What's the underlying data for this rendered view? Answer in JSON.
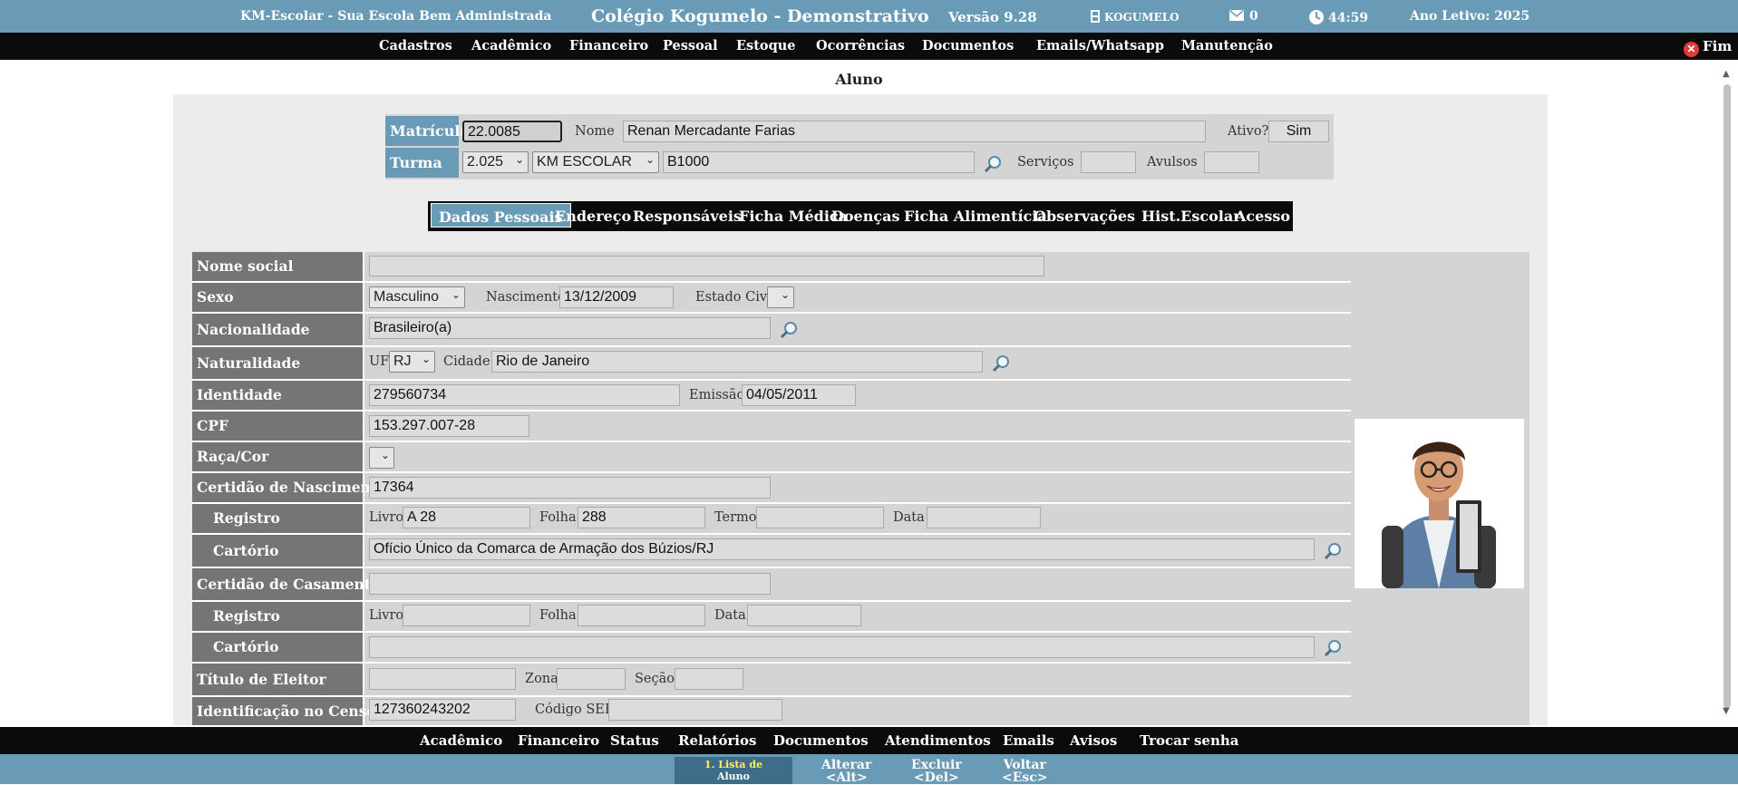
{
  "topbar": {
    "system_name": "KM-Escolar - Sua Escola Bem Administrada",
    "school_name": "Colégio Kogumelo - Demonstrativo",
    "version": "Versão 9.28",
    "user": "KOGUMELO",
    "messages": "0",
    "clock": "44:59",
    "school_year": "Ano Letivo: 2025"
  },
  "menu": {
    "items": [
      "Cadastros",
      "Acadêmico",
      "Financeiro",
      "Pessoal",
      "Estoque",
      "Ocorrências",
      "Documentos",
      "Emails/Whatsapp",
      "Manutenção"
    ],
    "exit": "Fim"
  },
  "page": {
    "title": "Aluno"
  },
  "header": {
    "matricula_label": "Matrícula",
    "matricula": "22.0085",
    "nome_label": "Nome",
    "nome": "Renan Mercadante Farias",
    "ativo_label": "Ativo?",
    "ativo": "Sim",
    "turma_label": "Turma",
    "ano": "2.025",
    "curso": "KM ESCOLAR",
    "turma": "B1000",
    "servicos_label": "Serviços",
    "servicos": "",
    "avulsos_label": "Avulsos",
    "avulsos": ""
  },
  "tabs": [
    "Dados Pessoais",
    "Endereço",
    "Responsáveis",
    "Ficha Médica",
    "Doenças",
    "Ficha Alimentícia",
    "Observações",
    "Hist.Escolar",
    "Acesso"
  ],
  "form": {
    "nome_social_label": "Nome social",
    "nome_social": "",
    "sexo_label": "Sexo",
    "sexo": "Masculino",
    "nascimento_label": "Nascimento",
    "nascimento": "13/12/2009",
    "estado_civil_label": "Estado Civil",
    "estado_civil": "",
    "nacionalidade_label": "Nacionalidade",
    "nacionalidade": "Brasileiro(a)",
    "naturalidade_label": "Naturalidade",
    "uf_label": "UF",
    "uf": "RJ",
    "cidade_label": "Cidade",
    "cidade": "Rio de Janeiro",
    "identidade_label": "Identidade",
    "identidade": "279560734",
    "emissao_label": "Emissão",
    "emissao": "04/05/2011",
    "cpf_label": "CPF",
    "cpf": "153.297.007-28",
    "raca_label": "Raça/Cor",
    "raca": "",
    "cert_nasc_label": "Certidão de Nascimento",
    "cert_nasc": "17364",
    "registro_label": "Registro",
    "livro_label": "Livro",
    "livro": "A 28",
    "folha_label": "Folha",
    "folha": "288",
    "termo_label": "Termo",
    "termo": "",
    "data_label": "Data",
    "data": "",
    "cartorio_label": "Cartório",
    "cartorio": "Ofício Único da Comarca de Armação dos Búzios/RJ",
    "cert_cas_label": "Certidão de Casamento",
    "cert_cas": "",
    "cas_registro_label": "Registro",
    "cas_livro_label": "Livro",
    "cas_livro": "",
    "cas_folha_label": "Folha",
    "cas_folha": "",
    "cas_data_label": "Data",
    "cas_data": "",
    "cas_cartorio_label": "Cartório",
    "cas_cartorio": "",
    "titulo_label": "Título de Eleitor",
    "titulo": "",
    "zona_label": "Zona",
    "zona": "",
    "secao_label": "Seção",
    "secao": "",
    "censo_label": "Identificação no Censo",
    "censo": "127360243202",
    "codigo_see_label": "Código SEE",
    "codigo_see": ""
  },
  "bottom_nav": [
    "Acadêmico",
    "Financeiro",
    "Status",
    "Relatórios",
    "Documentos",
    "Atendimentos",
    "Emails",
    "Avisos",
    "Trocar senha"
  ],
  "actions": {
    "list_line1": "1. Lista de",
    "list_line2": "Aluno",
    "alterar": "Alterar",
    "alterar_key": "<Alt>",
    "excluir": "Excluir",
    "excluir_key": "<Del>",
    "voltar": "Voltar",
    "voltar_key": "<Esc>"
  },
  "colors": {
    "accent": "#6a9bb6",
    "bar": "#0b0b0b",
    "label_cell": "#757575",
    "field_bg": "#d4d4d4"
  }
}
